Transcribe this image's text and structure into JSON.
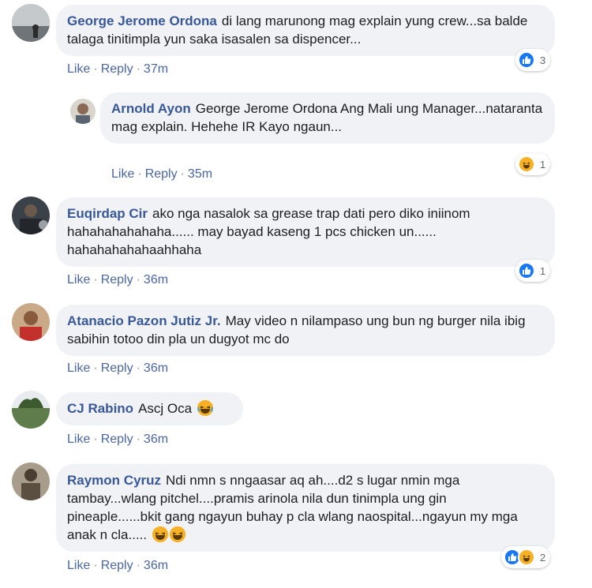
{
  "actions": {
    "like": "Like",
    "reply": "Reply",
    "sep": "·"
  },
  "comments": [
    {
      "author": "George Jerome Ordona",
      "text": "di lang marunong mag explain yung crew...sa balde talaga tinitimpla yun saka isasalen sa dispencer...",
      "time": "37m",
      "reaction_count": "3",
      "reactions": [
        "like-icon"
      ]
    },
    {
      "author": "Arnold Ayon",
      "text": "George Jerome Ordona Ang Mali ung Manager...nataranta mag explain. Hehehe IR Kayo ngaun...",
      "time": "35m",
      "reaction_count": "1",
      "reactions": [
        "haha-icon"
      ]
    },
    {
      "author": "Euqirdap Cir",
      "text": "ako nga nasalok sa grease trap dati pero diko iniinom hahahahahahaha...... may bayad kaseng 1 pcs chicken un...... hahahahahahaahhaha",
      "time": "36m",
      "reaction_count": "1",
      "reactions": [
        "like-icon"
      ]
    },
    {
      "author": "Atanacio Pazon Jutiz Jr.",
      "text": "May video n nilampaso ung bun ng burger nila ibig sabihin totoo din pla un dugyot mc do",
      "time": "36m"
    },
    {
      "author": "CJ Rabino",
      "text": "Ascj Oca",
      "time": "36m"
    },
    {
      "author": "Raymon Cyruz",
      "text": "Ndi nmn s nngaasar aq ah....d2 s lugar nmin mga tambay...wlang pitchel....pramis arinola nila dun tinimpla ung gin pineaple......bkit gang ngayun buhay p cla wlang naospital...ngayun my mga anak n cla.....",
      "time": "36m",
      "reaction_count": "2",
      "reactions": [
        "like-icon",
        "haha-icon"
      ]
    }
  ]
}
